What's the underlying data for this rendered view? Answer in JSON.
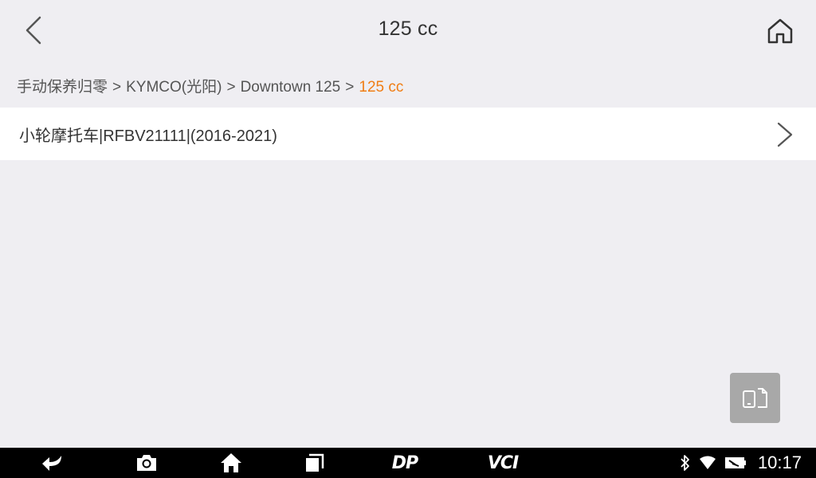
{
  "header": {
    "title": "125 cc",
    "back_icon": "chevron-left-icon",
    "home_icon": "home-icon"
  },
  "breadcrumb": {
    "items": [
      "手动保养归零",
      "KYMCO(光阳)",
      "Downtown 125"
    ],
    "separator": ">",
    "current": "125 cc",
    "current_color": "#f07d14"
  },
  "list": {
    "items": [
      {
        "label": "小轮摩托车|RFBV21111|(2016-2021)"
      }
    ]
  },
  "floating_button": {
    "icon": "screen-switch-icon"
  },
  "navbar": {
    "icons": [
      "back-arrow-icon",
      "camera-icon",
      "home-icon",
      "recent-apps-icon"
    ],
    "dp_label": "DP",
    "vci_label": "VCI"
  },
  "status": {
    "icons": [
      "bluetooth-icon",
      "wifi-icon",
      "battery-icon"
    ],
    "time": "10:17"
  },
  "colors": {
    "background": "#efeef2",
    "accent": "#f07d14",
    "navbar": "#000000"
  }
}
